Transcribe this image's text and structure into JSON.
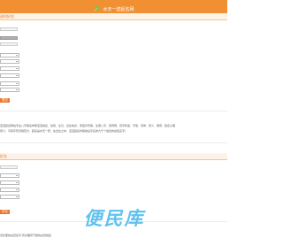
{
  "header": {
    "title": "水天一碧起名网",
    "accent_color": "#f19033"
  },
  "form": {
    "section_title": "孩时好名",
    "surname_value": "",
    "birthday_value": "",
    "submit_label": "提交"
  },
  "intro": {
    "lines": [
      "宝宝起名网站专业八字取名参照宝宝姓名、性别、生日、出生地点、家庭背景等，生辰八字、易周网、真字利度、字型、音律、意义、寓意、起名心理",
      "意义、可视字形高规范分、起名是水天一碧，在出生之中，宝宝起名时取前后字名的九千个组合的最佳名字！"
    ]
  },
  "second_form": {
    "section_title": "好名",
    "button_label": "好名"
  },
  "watermark": {
    "text": "便民库"
  },
  "footer": {
    "text": "诗文里的女孩名字,有文雅有气质的女孩姓名"
  }
}
